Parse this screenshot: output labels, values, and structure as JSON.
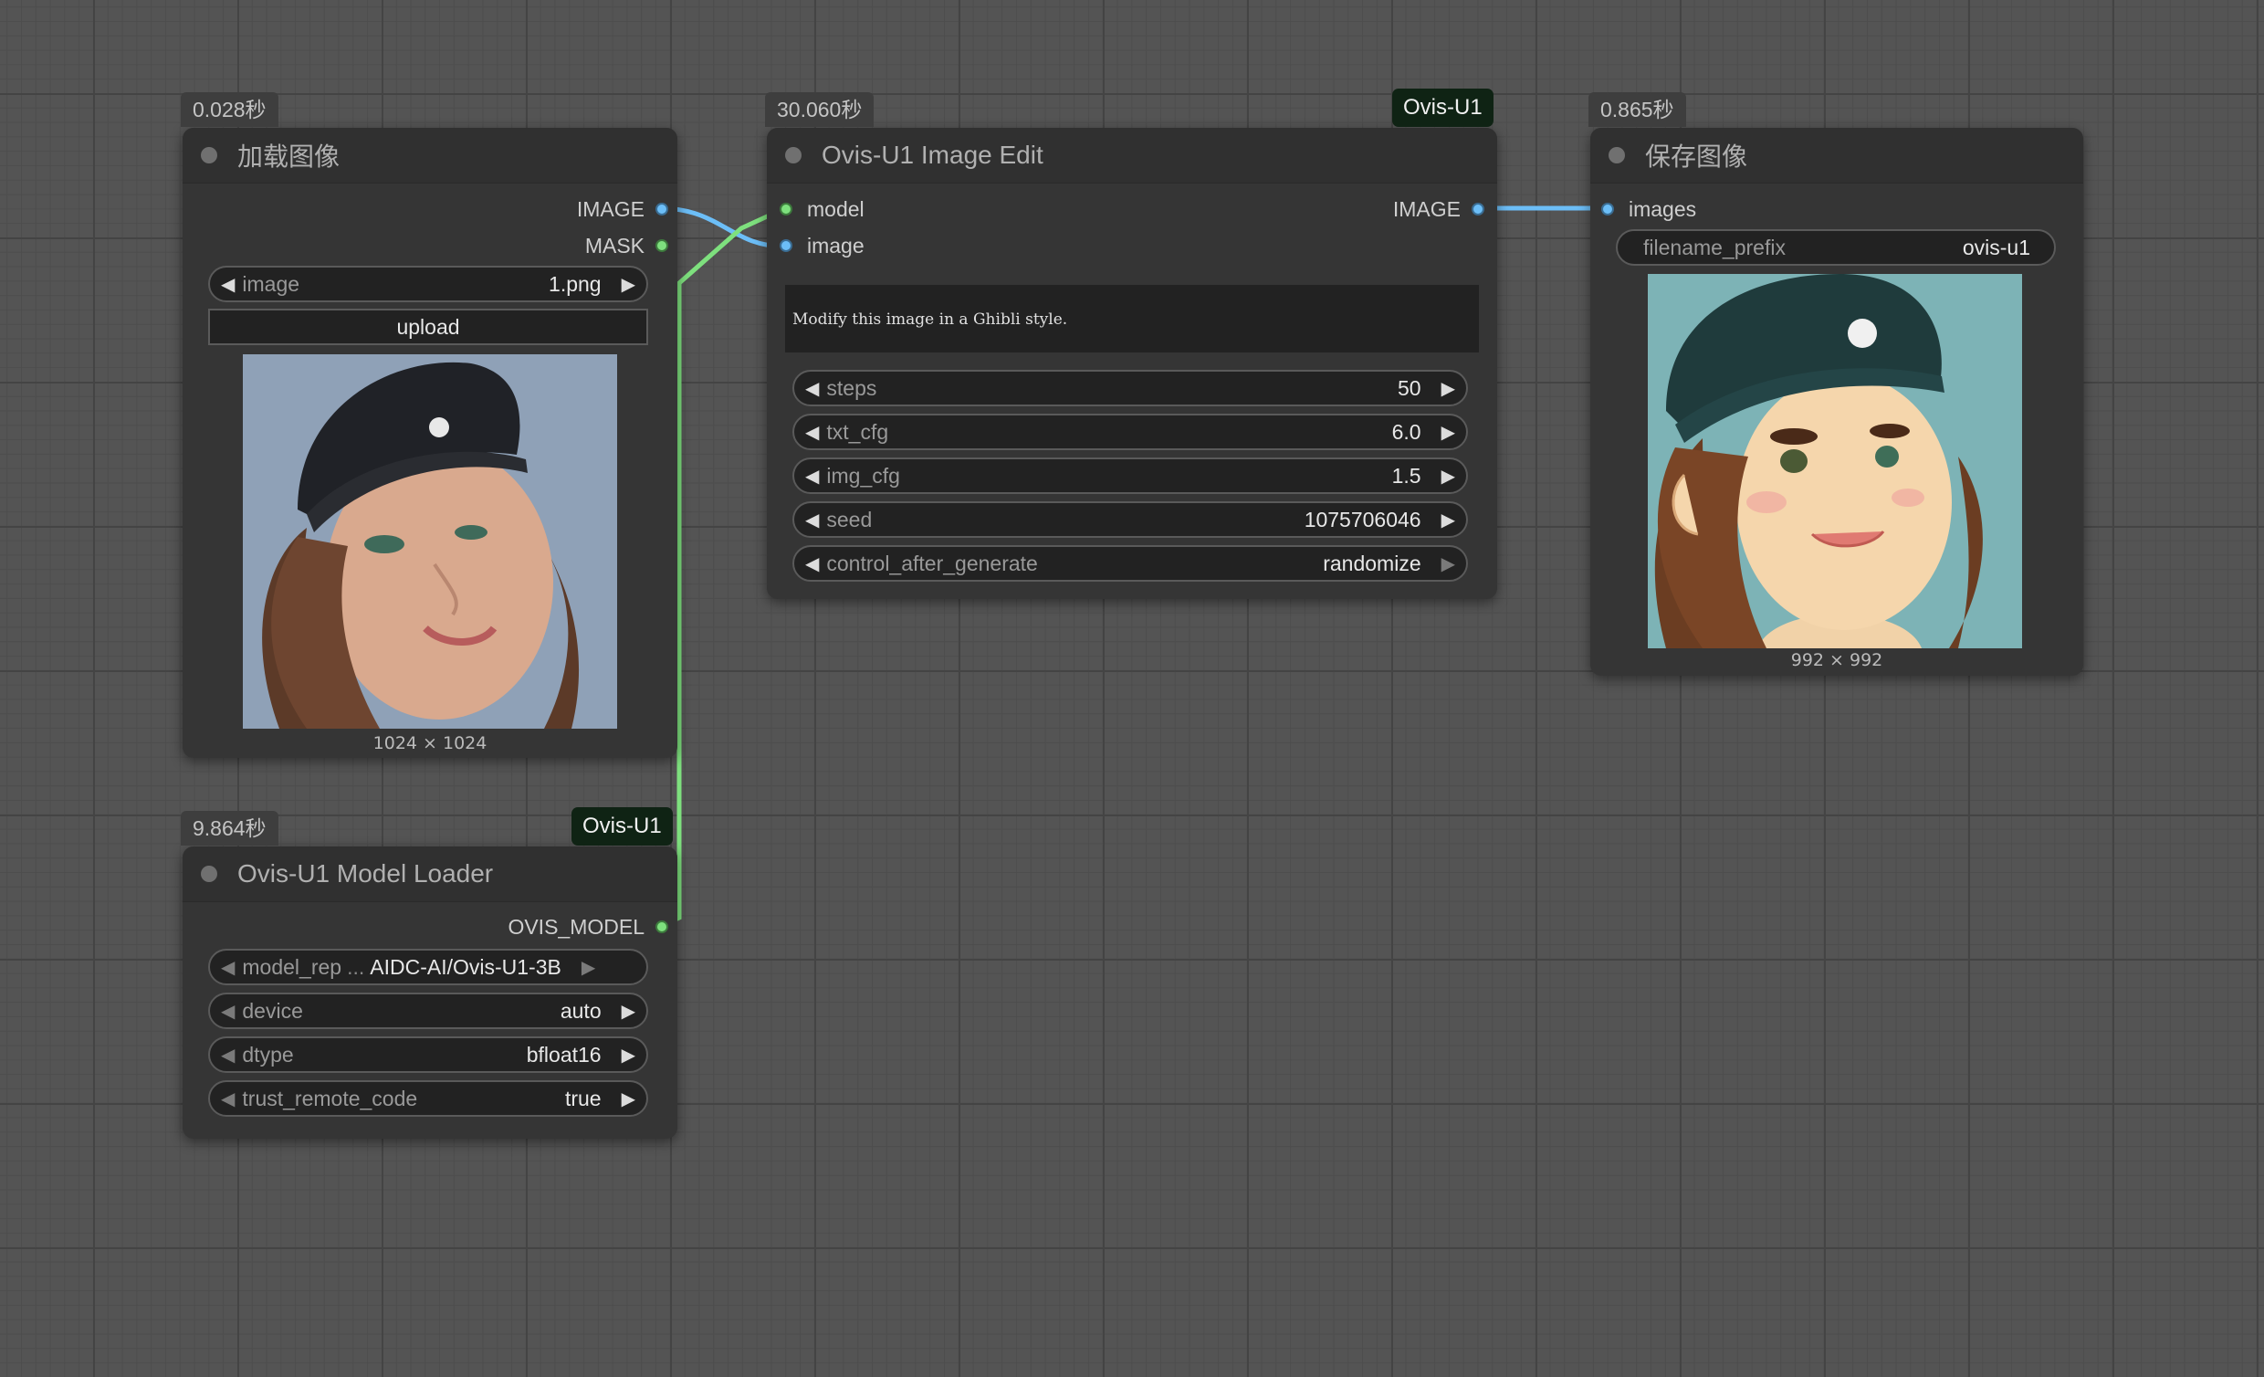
{
  "load_image": {
    "time": "0.028秒",
    "title": "加载图像",
    "outputs": [
      "IMAGE",
      "MASK"
    ],
    "image_label": "image",
    "image_value": "1.png",
    "upload_label": "upload",
    "image_size": "1024 × 1024"
  },
  "model_loader": {
    "time": "9.864秒",
    "tag": "Ovis-U1",
    "title": "Ovis-U1 Model Loader",
    "output": "OVIS_MODEL",
    "widgets": [
      {
        "label": "model_rep",
        "ellipsis": "...",
        "value": "AIDC-AI/Ovis-U1-3B"
      },
      {
        "label": "device",
        "value": "auto"
      },
      {
        "label": "dtype",
        "value": "bfloat16"
      },
      {
        "label": "trust_remote_code",
        "value": "true"
      }
    ]
  },
  "image_edit": {
    "time": "30.060秒",
    "tag": "Ovis-U1",
    "title": "Ovis-U1 Image Edit",
    "inputs": [
      "model",
      "image"
    ],
    "output": "IMAGE",
    "prompt": "Modify this image in a Ghibli style.",
    "widgets": [
      {
        "label": "steps",
        "value": "50"
      },
      {
        "label": "txt_cfg",
        "value": "6.0"
      },
      {
        "label": "img_cfg",
        "value": "1.5"
      },
      {
        "label": "seed",
        "value": "1075706046"
      },
      {
        "label": "control_after_generate",
        "value": "randomize"
      }
    ]
  },
  "save_image": {
    "time": "0.865秒",
    "title": "保存图像",
    "input": "images",
    "prefix_label": "filename_prefix",
    "prefix_value": "ovis-u1",
    "image_size": "992 × 992"
  },
  "colors": {
    "canvas": "#545454",
    "node": "#353535",
    "link_image": "#6cbef7",
    "link_model": "#7ee07e",
    "tag_bg": "#0f2314"
  }
}
